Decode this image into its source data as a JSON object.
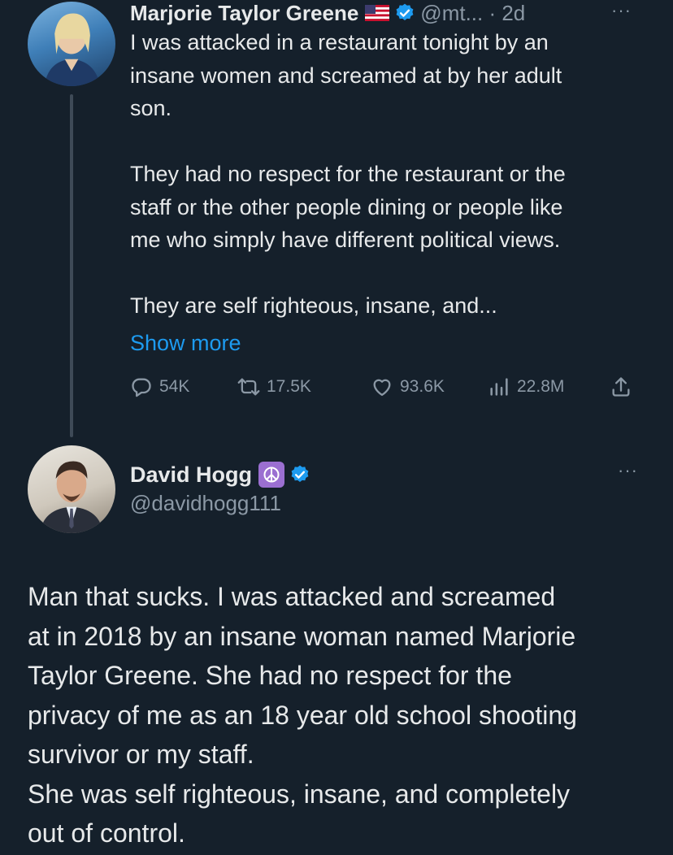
{
  "tweet1": {
    "author_name": "Marjorie Taylor Greene",
    "flag_icon": "us-flag-icon",
    "handle_time": "@mt... · 2d",
    "more": "···",
    "text": "I was attacked in a restaurant tonight by an\ninsane women and screamed at by her adult\nson.\n\nThey had no respect for the restaurant or the\nstaff or the other people dining or people like\nme who simply have different political views.\n\nThey are self righteous, insane, and...",
    "show_more": "Show more",
    "stats": {
      "replies": "54K",
      "retweets": "17.5K",
      "likes": "93.6K",
      "views": "22.8M"
    }
  },
  "tweet2": {
    "author_name": "David Hogg",
    "badge_icon": "peace-sign-icon",
    "handle": "@davidhogg111",
    "more": "···",
    "text": "Man that sucks. I was attacked and screamed\nat in 2018 by an insane woman named Marjorie\nTaylor Greene. She had no respect for the\nprivacy of me as an 18 year old school shooting\nsurvivor or my staff.\nShe was self righteous, insane, and completely\nout of control."
  },
  "colors": {
    "background": "#15202b",
    "text": "#e7e9ea",
    "secondary": "#8b98a5",
    "link": "#1d9bf0",
    "verified": "#1d9bf0"
  }
}
